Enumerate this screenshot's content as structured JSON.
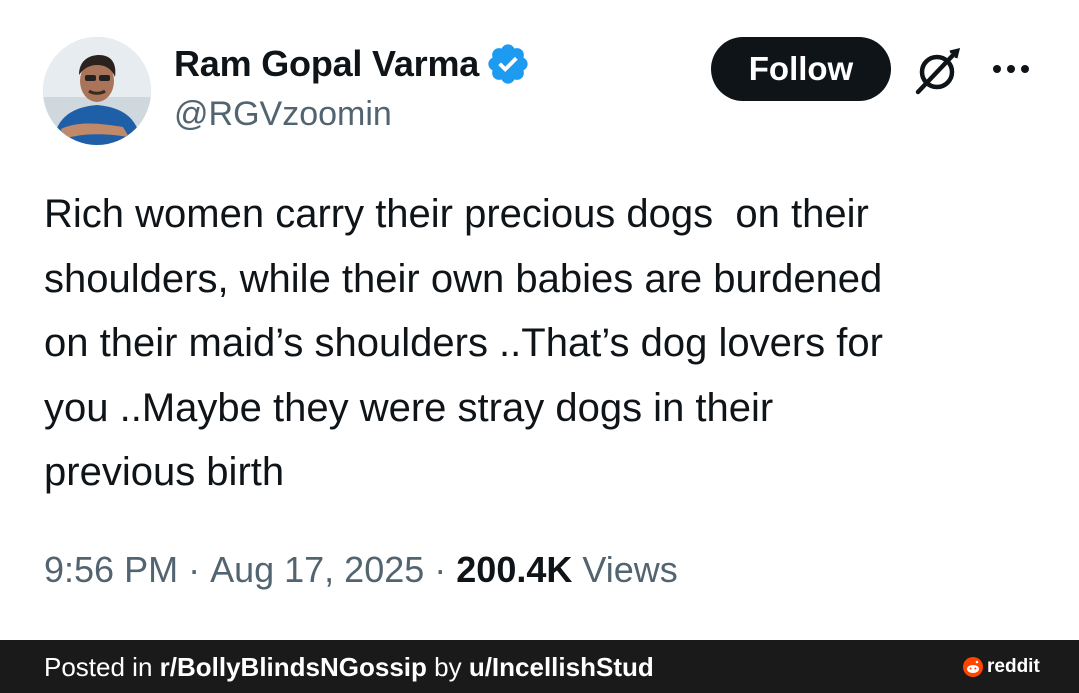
{
  "author": {
    "display_name": "Ram Gopal Varma",
    "handle": "@RGVzoomin",
    "verified_color": "#1d9bf0",
    "avatar_icon": "profile-photo"
  },
  "actions": {
    "follow_label": "Follow",
    "grok_icon": "grok-icon",
    "more_icon": "more-icon"
  },
  "tweet": {
    "text": "Rich women carry their precious dogs  on their\nshoulders, while their own babies are burdened\non their maid’s shoulders ..That’s dog lovers for\nyou ..Maybe they were stray dogs in their\nprevious birth"
  },
  "meta": {
    "time": "9:56 PM",
    "separator": "·",
    "date": "Aug 17, 2025",
    "views_count": "200.4K",
    "views_label": "Views"
  },
  "footer": {
    "posted_in": "Posted in ",
    "subreddit": "r/BollyBlindsNGossip",
    "by": " by ",
    "user": "u/IncellishStud",
    "brand": "reddit",
    "brand_color": "#ff4500"
  }
}
